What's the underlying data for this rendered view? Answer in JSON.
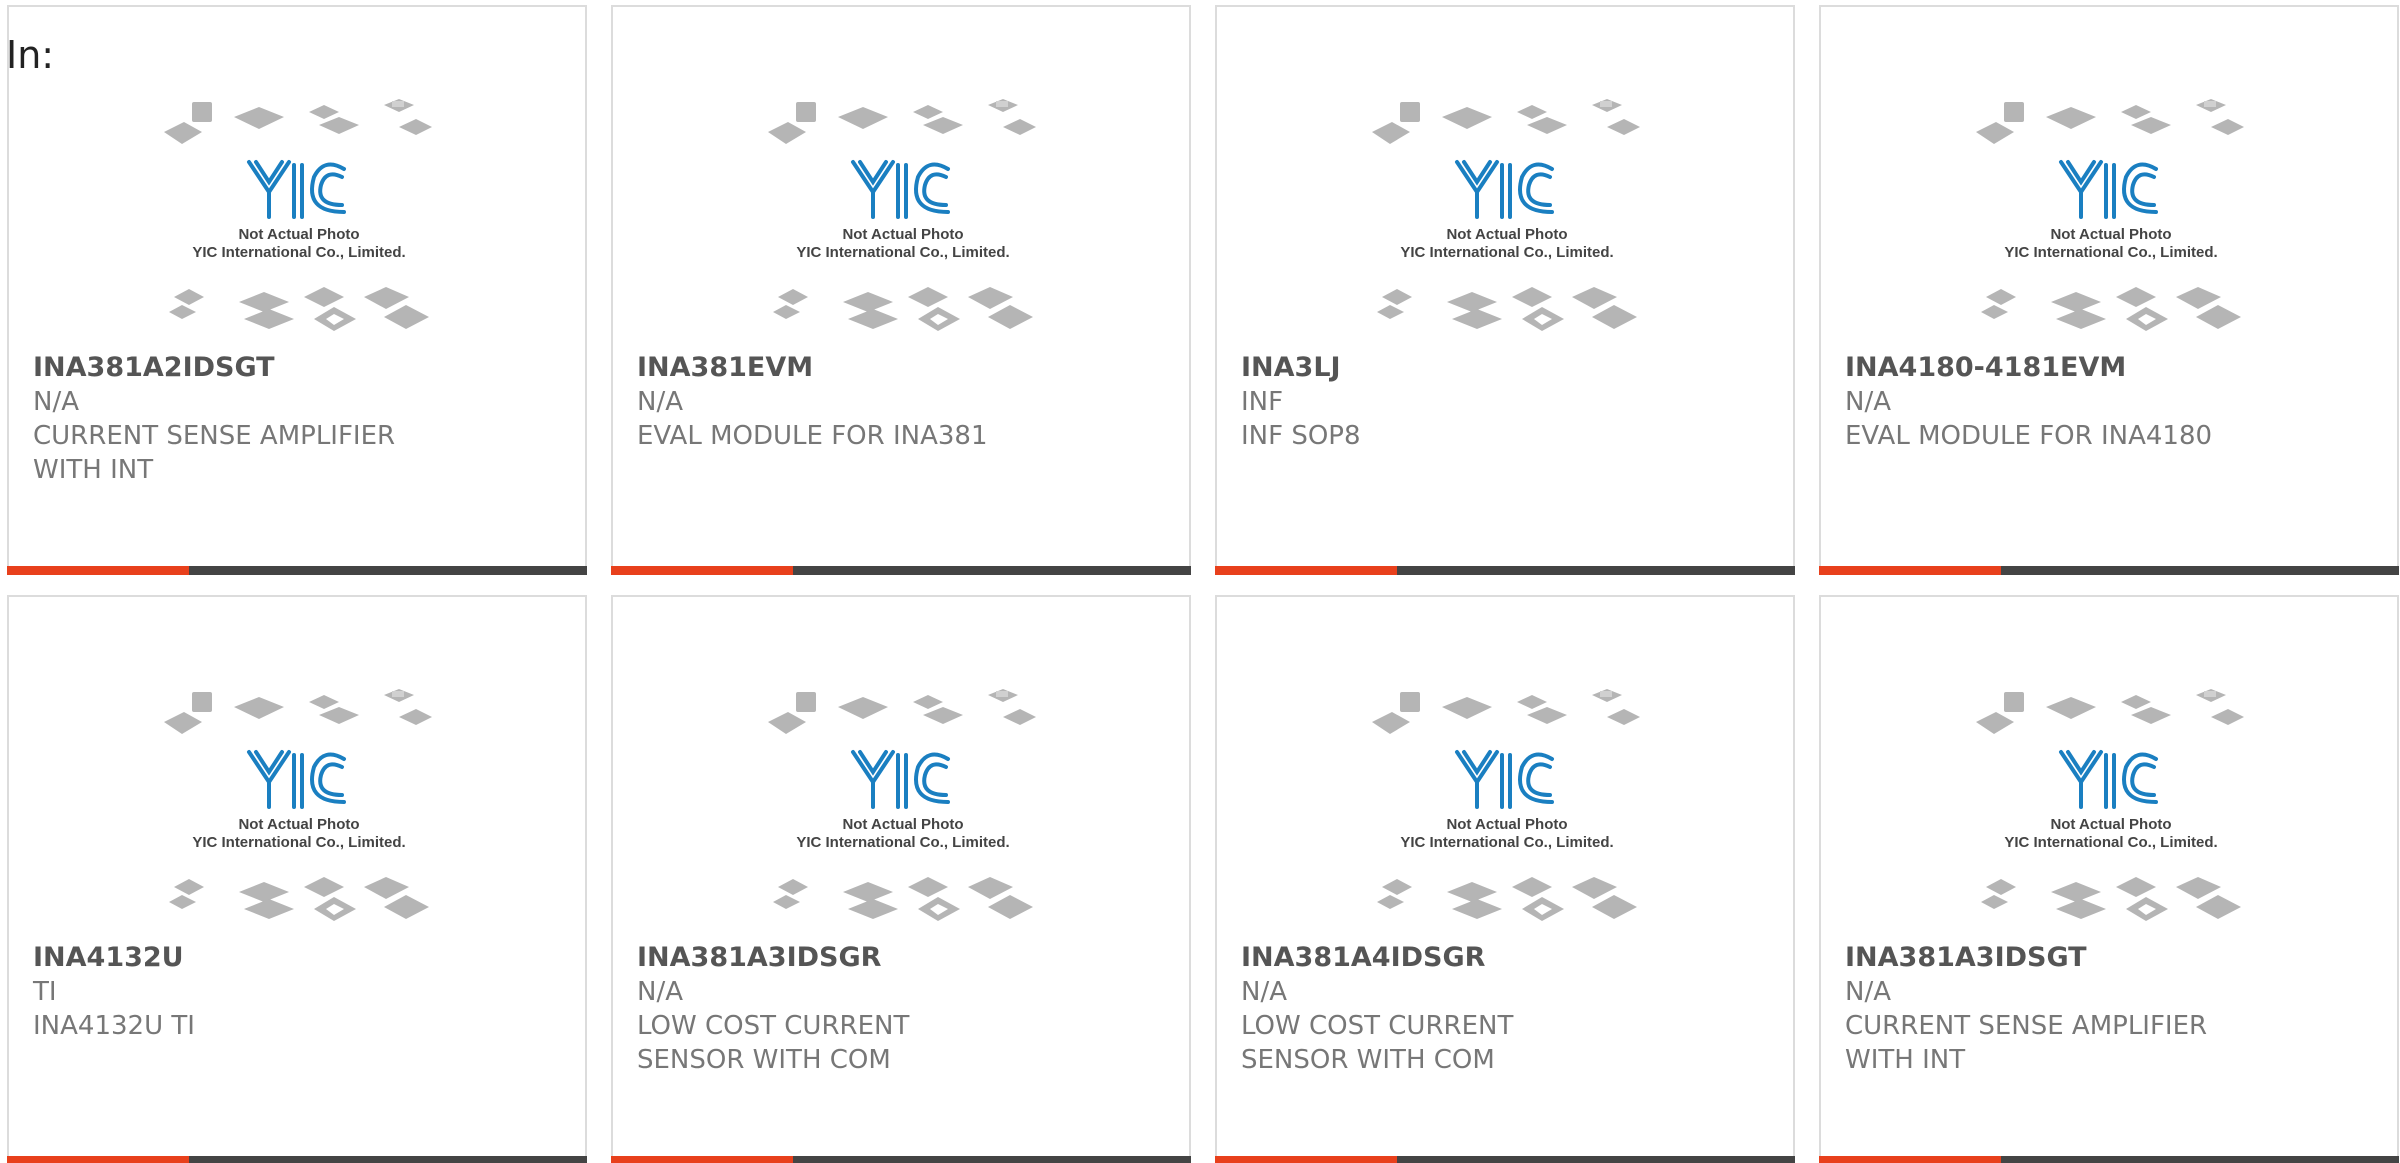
{
  "header": {
    "label": "In:"
  },
  "placeholder": {
    "line1": "Not Actual Photo",
    "line2": "YIC International Co., Limited.",
    "logo_text": "YIC",
    "icon": "chip-package-placeholder-icon"
  },
  "colors": {
    "accent": "#e8401c",
    "bar": "#444444",
    "logo": "#1a7fc1"
  },
  "products": [
    {
      "part": "INA381A2IDSGT",
      "brand": "N/A",
      "desc": "CURRENT SENSE AMPLIFIER WITH INT"
    },
    {
      "part": "INA381EVM",
      "brand": "N/A",
      "desc": "EVAL MODULE FOR INA381"
    },
    {
      "part": "INA3LJ",
      "brand": "INF",
      "desc": "INF SOP8"
    },
    {
      "part": "INA4180-4181EVM",
      "brand": "N/A",
      "desc": "EVAL MODULE FOR INA4180"
    },
    {
      "part": "INA4132U",
      "brand": "TI",
      "desc": "INA4132U TI"
    },
    {
      "part": "INA381A3IDSGR",
      "brand": "N/A",
      "desc": "LOW COST CURRENT SENSOR WITH COM"
    },
    {
      "part": "INA381A4IDSGR",
      "brand": "N/A",
      "desc": "LOW COST CURRENT SENSOR WITH COM"
    },
    {
      "part": "INA381A3IDSGT",
      "brand": "N/A",
      "desc": "CURRENT SENSE AMPLIFIER WITH INT"
    }
  ]
}
